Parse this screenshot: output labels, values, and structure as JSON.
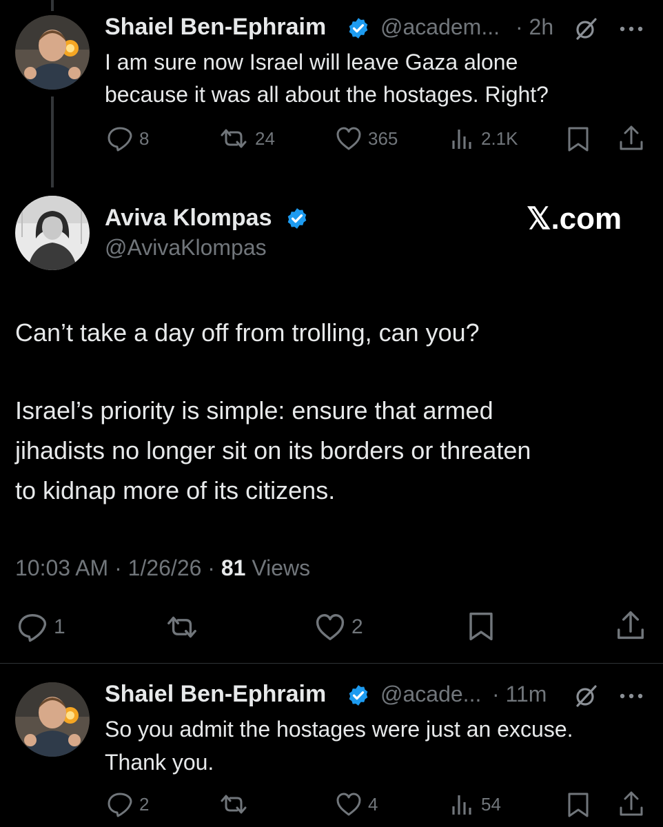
{
  "colors": {
    "background": "#000000",
    "text": "#e7e9ea",
    "muted": "#71767b",
    "verified": "#1d9bf0"
  },
  "tweet1": {
    "name": "Shaiel Ben-Ephraim",
    "handle": "@academ...",
    "time": "· 2h",
    "text_line1": "I am sure now Israel will leave Gaza alone",
    "text_line2": "because it was all about the hostages. Right?",
    "replies": "8",
    "reposts": "24",
    "likes": "365",
    "views": "2.1K",
    "icons": [
      "grok-icon",
      "more-icon",
      "reply-icon",
      "repost-icon",
      "like-icon",
      "views-icon",
      "bookmark-icon",
      "share-icon"
    ]
  },
  "main": {
    "name": "Aviva Klompas",
    "handle": "@AvivaKlompas",
    "watermark": "𝕏.com",
    "paragraph1": "Can’t take a day off from trolling, can you?",
    "paragraph2_line1": "Israel’s priority is simple: ensure that armed",
    "paragraph2_line2": "jihadists no longer sit on its borders or threaten",
    "paragraph2_line3": "to kidnap more of its citizens.",
    "timestamp": "10:03 AM · 1/26/26 · ",
    "views_count": "81",
    "views_label": " Views",
    "replies": "1",
    "likes": "2"
  },
  "tweet3": {
    "name": "Shaiel Ben-Ephraim",
    "handle": "@acade...",
    "time": "· 11m",
    "text_line1": "So you admit the hostages were just an excuse.",
    "text_line2": "Thank you.",
    "replies": "2",
    "likes": "4",
    "views": "54"
  }
}
